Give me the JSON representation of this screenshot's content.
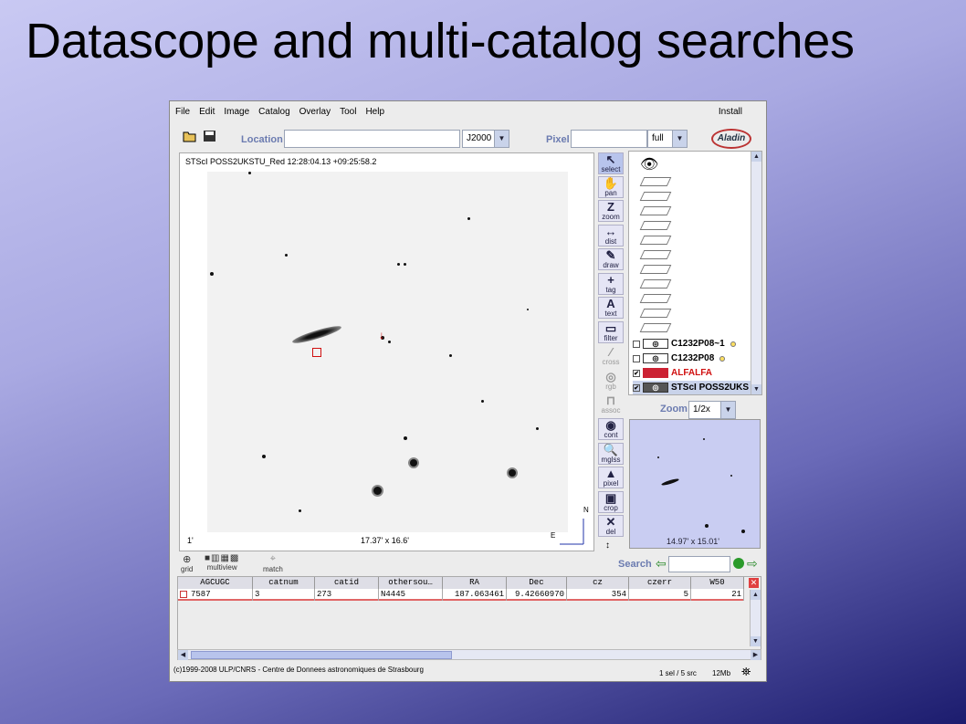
{
  "slide": {
    "title": "Datascope and multi-catalog searches"
  },
  "menu": {
    "items": [
      "File",
      "Edit",
      "Image",
      "Catalog",
      "Overlay",
      "Tool",
      "Help"
    ],
    "install": "Install"
  },
  "toolbar": {
    "location_label": "Location",
    "location_value": "",
    "frame_value": "J2000",
    "pixel_label": "Pixel",
    "pixel_value": "",
    "pixel_mode": "full",
    "logo_text": "Aladin"
  },
  "view": {
    "title": "STScI POSS2UKSTU_Red 12:28:04.13 +09:25:58.2",
    "scale_left": "1'",
    "scale_center": "17.37' x 16.6'",
    "north": "N",
    "east": "E"
  },
  "tools": [
    {
      "label": "select",
      "glyph": "↖",
      "state": "selected"
    },
    {
      "label": "pan",
      "glyph": "✋",
      "state": "on"
    },
    {
      "label": "zoom",
      "glyph": "Z",
      "state": "on"
    },
    {
      "label": "dist",
      "glyph": "↔",
      "state": "on"
    },
    {
      "label": "draw",
      "glyph": "✎",
      "state": "on"
    },
    {
      "label": "tag",
      "glyph": "+",
      "state": "on"
    },
    {
      "label": "text",
      "glyph": "A",
      "state": "on"
    },
    {
      "label": "filter",
      "glyph": "▭",
      "state": "on"
    },
    {
      "label": "cross",
      "glyph": "⁄",
      "state": "off"
    },
    {
      "label": "rgb",
      "glyph": "◎",
      "state": "off"
    },
    {
      "label": "assoc",
      "glyph": "⊓",
      "state": "off"
    },
    {
      "label": "cont",
      "glyph": "◉",
      "state": "on"
    },
    {
      "label": "mglss",
      "glyph": "🔍",
      "state": "on"
    },
    {
      "label": "pixel",
      "glyph": "▲",
      "state": "on"
    },
    {
      "label": "crop",
      "glyph": "▣",
      "state": "on"
    },
    {
      "label": "del",
      "glyph": "✕",
      "state": "on"
    }
  ],
  "layers": [
    {
      "name": "C1232P08~1",
      "checked": false,
      "color": "#000"
    },
    {
      "name": "C1232P08",
      "checked": false,
      "color": "#000"
    },
    {
      "name": "ALFALFA",
      "checked": true,
      "color": "#d01010"
    },
    {
      "name": "STScI POSS2UKS",
      "checked": true,
      "color": "#000"
    }
  ],
  "zoom": {
    "label": "Zoom",
    "value": "1/2x",
    "overview_caption": "14.97' x 15.01'"
  },
  "strip": {
    "grid": "grid",
    "multiview": "multiview",
    "match": "match",
    "search_label": "Search"
  },
  "table": {
    "columns": [
      "AGCUGC",
      "catnum",
      "catid",
      "othersou…",
      "RA",
      "Dec",
      "cz",
      "czerr",
      "W50"
    ],
    "rows": [
      [
        "7587",
        "3",
        "273",
        "N4445",
        "187.063461",
        "9.42660970",
        "354",
        "5",
        "21"
      ]
    ]
  },
  "status": {
    "copyright": "(c)1999-2008 ULP/CNRS - Centre de Donnees astronomiques de Strasbourg",
    "selection": "1 sel / 5 src",
    "memory": "12Mb"
  }
}
